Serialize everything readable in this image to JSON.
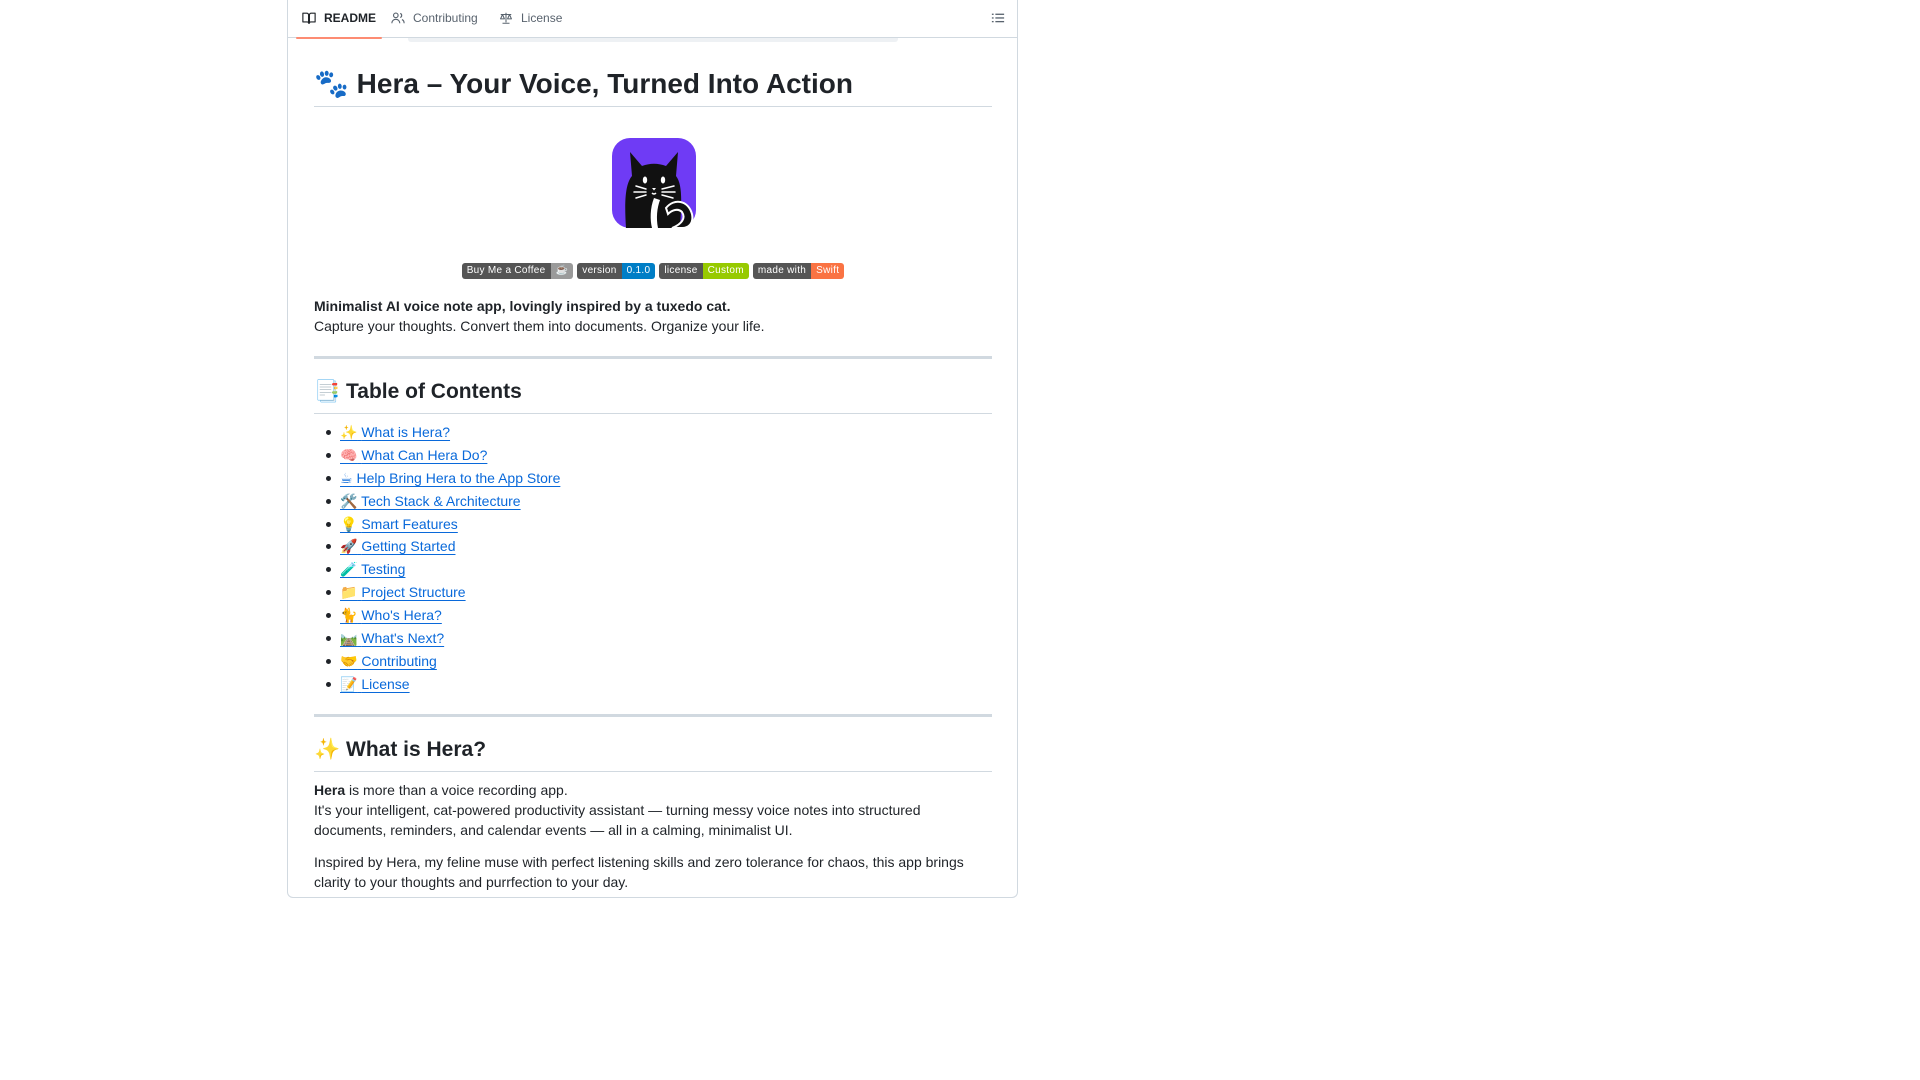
{
  "tabs": [
    {
      "label": "README",
      "icon": "book-icon"
    },
    {
      "label": "Contributing",
      "icon": "people-icon"
    },
    {
      "label": "License",
      "icon": "law-icon"
    }
  ],
  "readme": {
    "title_emoji": "🐾",
    "title": "Hera – Your Voice, Turned Into Action",
    "logo_alt": "cat-logo",
    "badges": [
      {
        "left": "Buy Me a Coffee",
        "right": "☕",
        "color": "#9a9a9a"
      },
      {
        "left": "version",
        "right": "0.1.0",
        "color": "#007ec6"
      },
      {
        "left": "license",
        "right": "Custom",
        "color": "#97ca00"
      },
      {
        "left": "made with",
        "right": "Swift",
        "color": "#fa7343"
      }
    ],
    "tagline": "Minimalist AI voice note app, lovingly inspired by a tuxedo cat.",
    "subtitle": "Capture your thoughts. Convert them into documents. Organize your life.",
    "toc_heading_emoji": "📑",
    "toc_heading": "Table of Contents",
    "toc": [
      {
        "emoji": "✨",
        "label": "What is Hera?"
      },
      {
        "emoji": "🧠",
        "label": "What Can Hera Do?"
      },
      {
        "emoji": "☕",
        "label": "Help Bring Hera to the App Store"
      },
      {
        "emoji": "🛠️",
        "label": "Tech Stack & Architecture"
      },
      {
        "emoji": "💡",
        "label": "Smart Features"
      },
      {
        "emoji": "🚀",
        "label": "Getting Started"
      },
      {
        "emoji": "🧪",
        "label": "Testing"
      },
      {
        "emoji": "📁",
        "label": "Project Structure"
      },
      {
        "emoji": "🐈",
        "label": "Who's Hera?"
      },
      {
        "emoji": "🛤️",
        "label": "What's Next?"
      },
      {
        "emoji": "🤝",
        "label": "Contributing"
      },
      {
        "emoji": "📝",
        "label": "License"
      }
    ],
    "what_heading_emoji": "✨",
    "what_heading": "What is Hera?",
    "what_p1_bold": "Hera",
    "what_p1_rest": " is more than a voice recording app.",
    "what_p2": "It's your intelligent, cat-powered productivity assistant — turning messy voice notes into structured documents, reminders, and calendar events — all in a calming, minimalist UI.",
    "what_p3": "Inspired by Hera, my feline muse with perfect listening skills and zero tolerance for chaos, this app brings clarity to your thoughts and purrfection to your day."
  },
  "colors": {
    "link": "#0969da",
    "accent_underline": "#fd8c73",
    "logo_bg": "#6f3bf5"
  }
}
